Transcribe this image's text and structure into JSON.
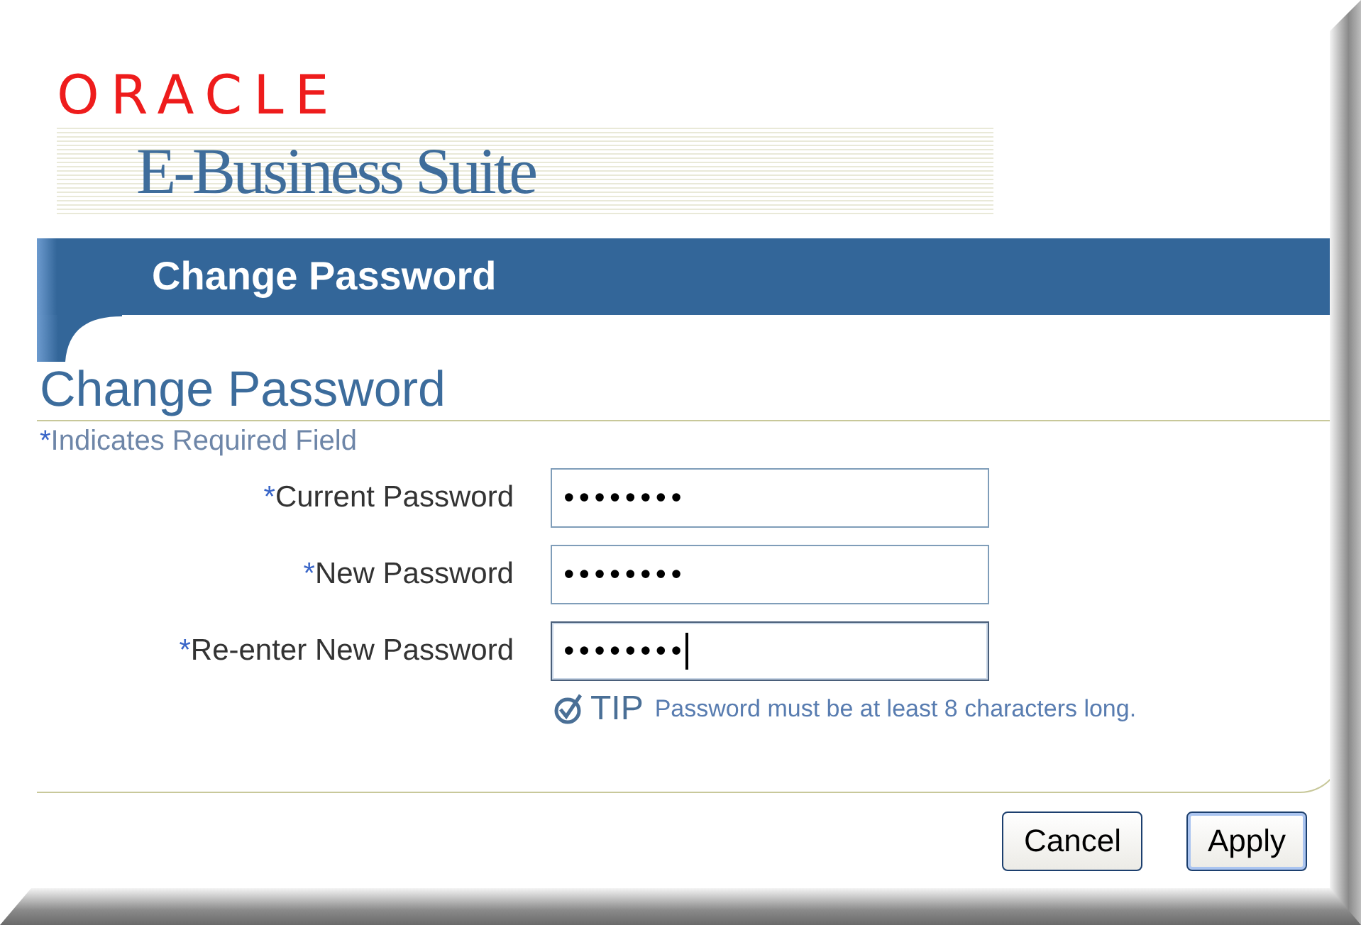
{
  "branding": {
    "company": "ORACLE",
    "product": "E-Business Suite"
  },
  "header_bar": {
    "title": "Change Password"
  },
  "page": {
    "title": "Change Password",
    "required_note": {
      "mark": "*",
      "text": "Indicates Required Field"
    }
  },
  "fields": [
    {
      "required_mark": "*",
      "label": "Current Password",
      "value": "••••••••",
      "focused": false
    },
    {
      "required_mark": "*",
      "label": "New Password",
      "value": "••••••••",
      "focused": false
    },
    {
      "required_mark": "*",
      "label": "Re-enter New Password",
      "value": "••••••••",
      "focused": true
    }
  ],
  "tip": {
    "label": "TIP",
    "text": "Password must be at least 8 characters long."
  },
  "buttons": [
    {
      "label": "Cancel",
      "default": false
    },
    {
      "label": "Apply",
      "default": true
    }
  ]
}
